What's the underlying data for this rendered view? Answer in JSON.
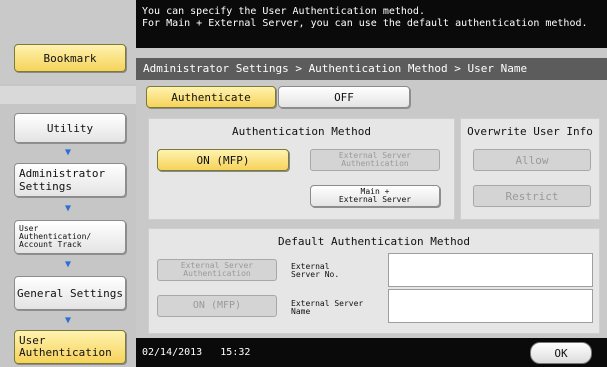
{
  "message": {
    "line1": "You can specify the User Authentication method.",
    "line2": "For Main + External Server, you can use the default authentication method."
  },
  "sidebar": {
    "bookmark": "Bookmark",
    "items": [
      {
        "label": "Utility"
      },
      {
        "label_line1": "Administrator",
        "label_line2": "Settings"
      },
      {
        "label_line1": "User",
        "label_line2": "Authentication/",
        "label_line3": "Account Track"
      },
      {
        "label": "General Settings"
      },
      {
        "label_line1": "User",
        "label_line2": "Authentication"
      }
    ]
  },
  "path": "Administrator Settings > Authentication Method > User Name",
  "tabs": {
    "authenticate": "Authenticate",
    "off": "OFF"
  },
  "auth_method": {
    "title": "Authentication Method",
    "on_mfp": "ON (MFP)",
    "external_line1": "External Server",
    "external_line2": "Authentication",
    "main_ext_line1": "Main +",
    "main_ext_line2": "External Server"
  },
  "overwrite": {
    "title": "Overwrite User Info",
    "allow": "Allow",
    "restrict": "Restrict"
  },
  "default_auth": {
    "title": "Default Authentication Method",
    "external_line1": "External Server",
    "external_line2": "Authentication",
    "on_mfp": "ON (MFP)",
    "server_no_line1": "External",
    "server_no_line2": "Server No.",
    "server_name_line1": "External Server",
    "server_name_line2": "Name",
    "server_no_value": "",
    "server_name_value": ""
  },
  "footer": {
    "date": "02/14/2013",
    "time": "15:32",
    "ok": "OK"
  },
  "colors": {
    "accent_yellow": "#f6d35a",
    "arrow_blue": "#2a6fd6",
    "message_bg": "#0a0a0a",
    "path_bg": "#5c5c5c"
  }
}
